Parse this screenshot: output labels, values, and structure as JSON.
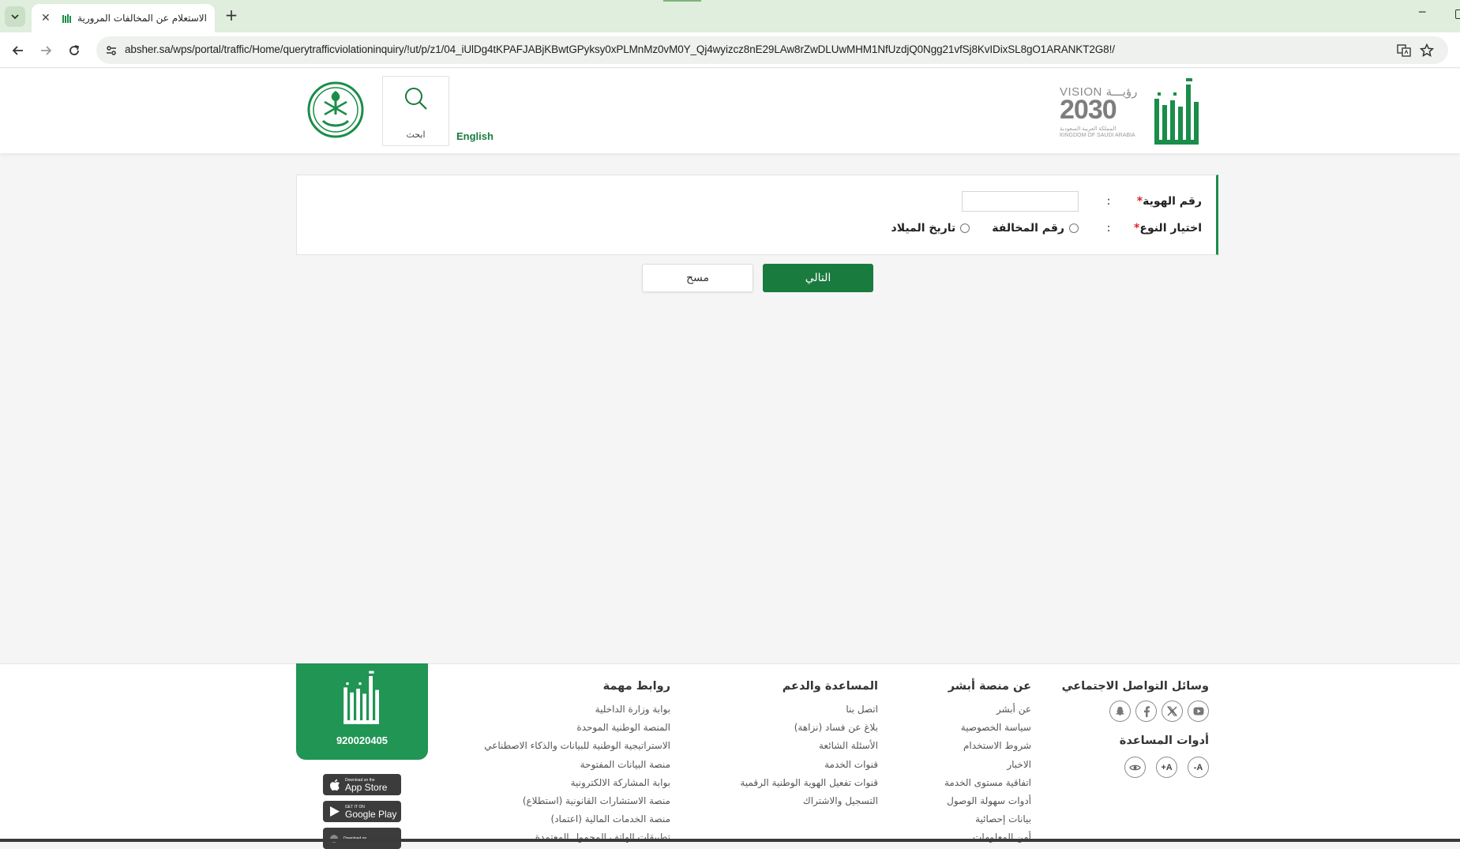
{
  "browser": {
    "tab_title": "الاستعلام عن المخالفات المرورية",
    "tab_close": "✕",
    "new_tab": "+",
    "url_host": "absher.sa",
    "url_path": "/wps/portal/traffic/Home/querytrafficviolationinquiry/!ut/p/z1/04_iUlDg4tKPAFJABjKBwtGPyksy0xPLMnMz0vM0Y_Qj4wyizcz8nE29LAw8rZwDLUwMHM1NfUzdjQ0Ngg21vfSj8KvIDixSL8gO1ARANKT2G8!/",
    "window_min": "─"
  },
  "header": {
    "vision_text": "VISION رؤيـــة",
    "vision_year": "2030",
    "vision_sub_ar": "المملكة العربية السعودية",
    "vision_sub_en": "KINGDOM OF SAUDI ARABIA",
    "language_link": "English",
    "search_label": "ابحث"
  },
  "form": {
    "id_label": "رقم الهوية",
    "required_mark": "*",
    "colon": ":",
    "id_value": "",
    "type_label": "اختيار النوع",
    "options": [
      "رقم المخالفة",
      "تاريخ الميلاد"
    ],
    "next_button": "التالي",
    "clear_button": "مسح"
  },
  "footer": {
    "social_title": "وسائل التواصل الاجتماعي",
    "help_title": "أدوات المساعدة",
    "help_buttons": [
      "-A",
      "+A"
    ],
    "about": {
      "title": "عن منصة أبشر",
      "items": [
        "عن أبشر",
        "سياسة الخصوصية",
        "شروط الاستخدام",
        "الاخبار",
        "اتفاقية مستوى الخدمة",
        "أدوات سهولة الوصول",
        "بيانات إحصائية",
        "أمن المعلومات"
      ]
    },
    "support": {
      "title": "المساعدة والدعم",
      "items": [
        "اتصل بنا",
        "بلاغ عن فساد (نزاهة)",
        "الأسئلة الشائعة",
        "قنوات الخدمة",
        "قنوات تفعيل الهوية الوطنية الرقمية",
        "التسجيل والاشتراك"
      ]
    },
    "links": {
      "title": "روابط مهمة",
      "items": [
        "بوابة وزارة الداخلية",
        "المنصة الوطنية الموحدة",
        "الاستراتيجية الوطنية للبيانات والذكاء الاصطناعي",
        "منصة البيانات المفتوحة",
        "بوابة المشاركة الالكترونية",
        "منصة الاستشارات القانونية (استطلاع)",
        "منصة الخدمات المالية (اعتماد)",
        "تطبيقات الهاتف المحمول المعتمدة"
      ]
    },
    "hotline": "920020405",
    "app_store": {
      "small": "Download on the",
      "big": "App Store"
    },
    "google_play": {
      "small": "GET IT ON",
      "big": "Google Play"
    },
    "third_store": {
      "small": "Download on"
    }
  },
  "colors": {
    "brand_green": "#1a7b3f",
    "hotline_green": "#209554",
    "required": "#dd2222"
  }
}
